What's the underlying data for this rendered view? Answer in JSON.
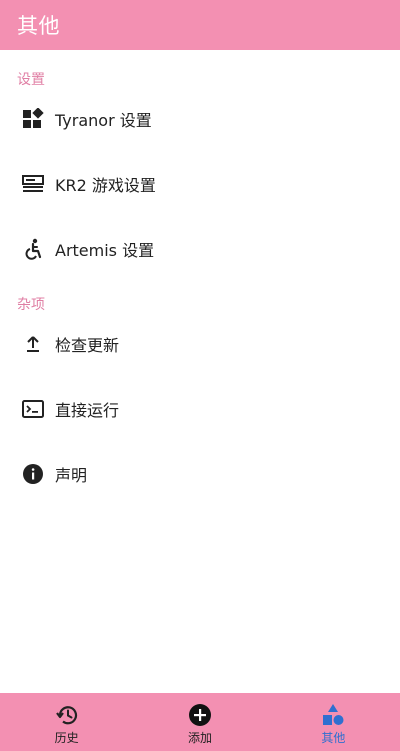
{
  "appbar": {
    "title": "其他"
  },
  "sections": [
    {
      "header": "设置",
      "items": [
        {
          "label": "Tyranor 设置",
          "icon": "widgets-icon"
        },
        {
          "label": "KR2 游戏设置",
          "icon": "settings-panel-icon"
        },
        {
          "label": "Artemis 设置",
          "icon": "accessible-icon"
        }
      ]
    },
    {
      "header": "杂项",
      "items": [
        {
          "label": "检查更新",
          "icon": "upload-icon"
        },
        {
          "label": "直接运行",
          "icon": "terminal-icon"
        },
        {
          "label": "声明",
          "icon": "info-icon"
        }
      ]
    }
  ],
  "bottom_nav": {
    "items": [
      {
        "label": "历史",
        "icon": "history-icon"
      },
      {
        "label": "添加",
        "icon": "add-circle-icon"
      },
      {
        "label": "其他",
        "icon": "shapes-icon",
        "active": true
      }
    ]
  },
  "colors": {
    "primary": "#f390b2",
    "section_header": "#e07fa4",
    "active_nav": "#2f6fd0"
  }
}
